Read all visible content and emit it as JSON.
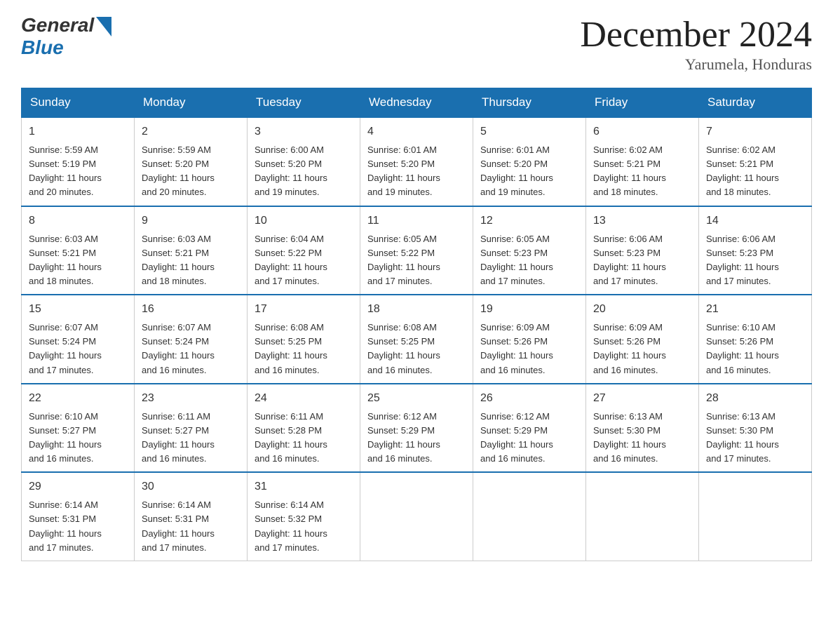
{
  "header": {
    "logo_general": "General",
    "logo_blue": "Blue",
    "title": "December 2024",
    "location": "Yarumela, Honduras"
  },
  "days_of_week": [
    "Sunday",
    "Monday",
    "Tuesday",
    "Wednesday",
    "Thursday",
    "Friday",
    "Saturday"
  ],
  "weeks": [
    [
      {
        "day": "1",
        "sunrise": "5:59 AM",
        "sunset": "5:19 PM",
        "daylight": "11 hours and 20 minutes."
      },
      {
        "day": "2",
        "sunrise": "5:59 AM",
        "sunset": "5:20 PM",
        "daylight": "11 hours and 20 minutes."
      },
      {
        "day": "3",
        "sunrise": "6:00 AM",
        "sunset": "5:20 PM",
        "daylight": "11 hours and 19 minutes."
      },
      {
        "day": "4",
        "sunrise": "6:01 AM",
        "sunset": "5:20 PM",
        "daylight": "11 hours and 19 minutes."
      },
      {
        "day": "5",
        "sunrise": "6:01 AM",
        "sunset": "5:20 PM",
        "daylight": "11 hours and 19 minutes."
      },
      {
        "day": "6",
        "sunrise": "6:02 AM",
        "sunset": "5:21 PM",
        "daylight": "11 hours and 18 minutes."
      },
      {
        "day": "7",
        "sunrise": "6:02 AM",
        "sunset": "5:21 PM",
        "daylight": "11 hours and 18 minutes."
      }
    ],
    [
      {
        "day": "8",
        "sunrise": "6:03 AM",
        "sunset": "5:21 PM",
        "daylight": "11 hours and 18 minutes."
      },
      {
        "day": "9",
        "sunrise": "6:03 AM",
        "sunset": "5:21 PM",
        "daylight": "11 hours and 18 minutes."
      },
      {
        "day": "10",
        "sunrise": "6:04 AM",
        "sunset": "5:22 PM",
        "daylight": "11 hours and 17 minutes."
      },
      {
        "day": "11",
        "sunrise": "6:05 AM",
        "sunset": "5:22 PM",
        "daylight": "11 hours and 17 minutes."
      },
      {
        "day": "12",
        "sunrise": "6:05 AM",
        "sunset": "5:23 PM",
        "daylight": "11 hours and 17 minutes."
      },
      {
        "day": "13",
        "sunrise": "6:06 AM",
        "sunset": "5:23 PM",
        "daylight": "11 hours and 17 minutes."
      },
      {
        "day": "14",
        "sunrise": "6:06 AM",
        "sunset": "5:23 PM",
        "daylight": "11 hours and 17 minutes."
      }
    ],
    [
      {
        "day": "15",
        "sunrise": "6:07 AM",
        "sunset": "5:24 PM",
        "daylight": "11 hours and 17 minutes."
      },
      {
        "day": "16",
        "sunrise": "6:07 AM",
        "sunset": "5:24 PM",
        "daylight": "11 hours and 16 minutes."
      },
      {
        "day": "17",
        "sunrise": "6:08 AM",
        "sunset": "5:25 PM",
        "daylight": "11 hours and 16 minutes."
      },
      {
        "day": "18",
        "sunrise": "6:08 AM",
        "sunset": "5:25 PM",
        "daylight": "11 hours and 16 minutes."
      },
      {
        "day": "19",
        "sunrise": "6:09 AM",
        "sunset": "5:26 PM",
        "daylight": "11 hours and 16 minutes."
      },
      {
        "day": "20",
        "sunrise": "6:09 AM",
        "sunset": "5:26 PM",
        "daylight": "11 hours and 16 minutes."
      },
      {
        "day": "21",
        "sunrise": "6:10 AM",
        "sunset": "5:26 PM",
        "daylight": "11 hours and 16 minutes."
      }
    ],
    [
      {
        "day": "22",
        "sunrise": "6:10 AM",
        "sunset": "5:27 PM",
        "daylight": "11 hours and 16 minutes."
      },
      {
        "day": "23",
        "sunrise": "6:11 AM",
        "sunset": "5:27 PM",
        "daylight": "11 hours and 16 minutes."
      },
      {
        "day": "24",
        "sunrise": "6:11 AM",
        "sunset": "5:28 PM",
        "daylight": "11 hours and 16 minutes."
      },
      {
        "day": "25",
        "sunrise": "6:12 AM",
        "sunset": "5:29 PM",
        "daylight": "11 hours and 16 minutes."
      },
      {
        "day": "26",
        "sunrise": "6:12 AM",
        "sunset": "5:29 PM",
        "daylight": "11 hours and 16 minutes."
      },
      {
        "day": "27",
        "sunrise": "6:13 AM",
        "sunset": "5:30 PM",
        "daylight": "11 hours and 16 minutes."
      },
      {
        "day": "28",
        "sunrise": "6:13 AM",
        "sunset": "5:30 PM",
        "daylight": "11 hours and 17 minutes."
      }
    ],
    [
      {
        "day": "29",
        "sunrise": "6:14 AM",
        "sunset": "5:31 PM",
        "daylight": "11 hours and 17 minutes."
      },
      {
        "day": "30",
        "sunrise": "6:14 AM",
        "sunset": "5:31 PM",
        "daylight": "11 hours and 17 minutes."
      },
      {
        "day": "31",
        "sunrise": "6:14 AM",
        "sunset": "5:32 PM",
        "daylight": "11 hours and 17 minutes."
      },
      null,
      null,
      null,
      null
    ]
  ],
  "labels": {
    "sunrise": "Sunrise:",
    "sunset": "Sunset:",
    "daylight": "Daylight:"
  }
}
